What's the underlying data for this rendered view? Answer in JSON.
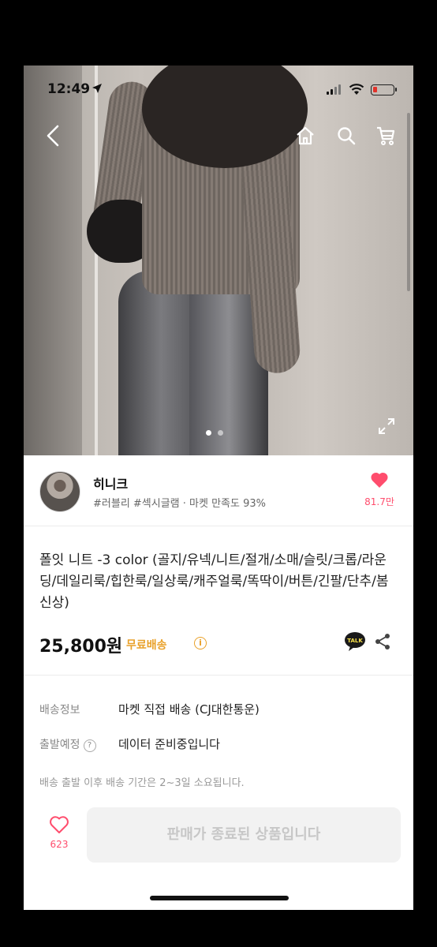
{
  "status_bar": {
    "time": "12:49"
  },
  "gallery": {
    "page_count": 2,
    "active_index": 0
  },
  "seller": {
    "name": "히니크",
    "tags": "#러블리 #섹시글램 · 마켓 만족도 93%",
    "like_count": "81.7만"
  },
  "product": {
    "title": "폴잇 니트 -3 color (골지/유넥/니트/절개/소매/슬릿/크롭/라운딩/데일리룩/힙한룩/일상룩/캐주얼룩/똑딱이/버튼/긴팔/단추/봄신상)",
    "price": "25,800원",
    "free_shipping": "무료배송"
  },
  "shipping": {
    "info_label": "배송정보",
    "info_value": "마켓 직접 배송 (CJ대한통운)",
    "departure_label": "출발예정",
    "departure_value": "데이터 준비중입니다",
    "note": "배송 출발 이후 배송 기간은 2~3일 소요됩니다."
  },
  "bottom_bar": {
    "like_count": "623",
    "soldout_label": "판매가 종료된 상품입니다"
  },
  "icons": {
    "talk_text": "TALK",
    "info_symbol": "i",
    "question_symbol": "?"
  },
  "colors": {
    "accent_pink": "#ff4d6d",
    "free_shipping": "#e9a12a",
    "battery_low": "#e2322a"
  }
}
